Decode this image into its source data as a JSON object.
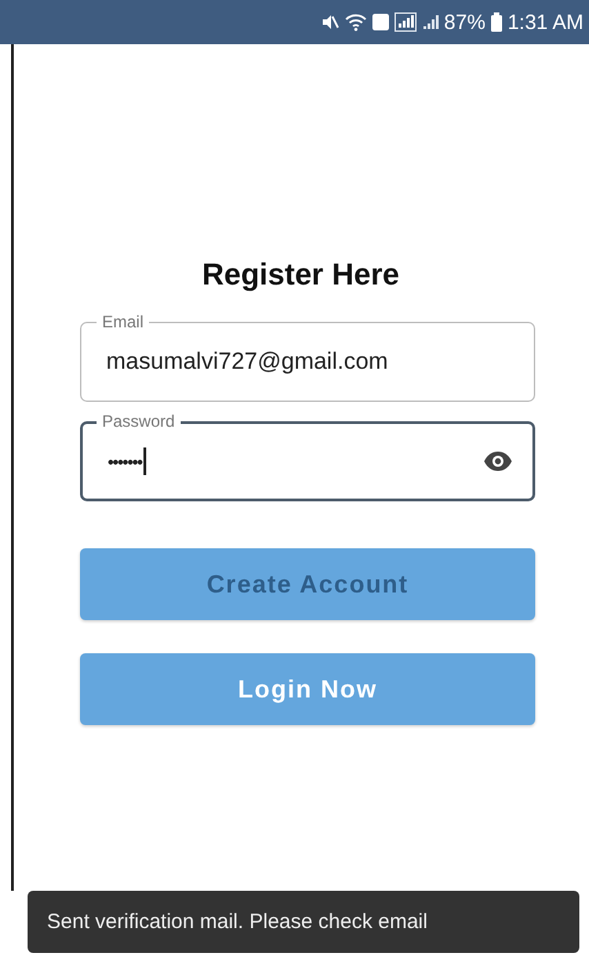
{
  "status_bar": {
    "battery": "87%",
    "time": "1:31 AM"
  },
  "title": "Register Here",
  "fields": [
    {
      "label": "Email",
      "value": "masumalvi727@gmail.com",
      "focused": false,
      "kind": "text"
    },
    {
      "label": "Password",
      "value": "•••••••",
      "focused": true,
      "kind": "password"
    }
  ],
  "buttons": [
    {
      "label": "Create Account",
      "disabled": true
    },
    {
      "label": "Login Now",
      "disabled": false
    }
  ],
  "snackbar": {
    "message": "Sent verification mail. Please check email"
  }
}
